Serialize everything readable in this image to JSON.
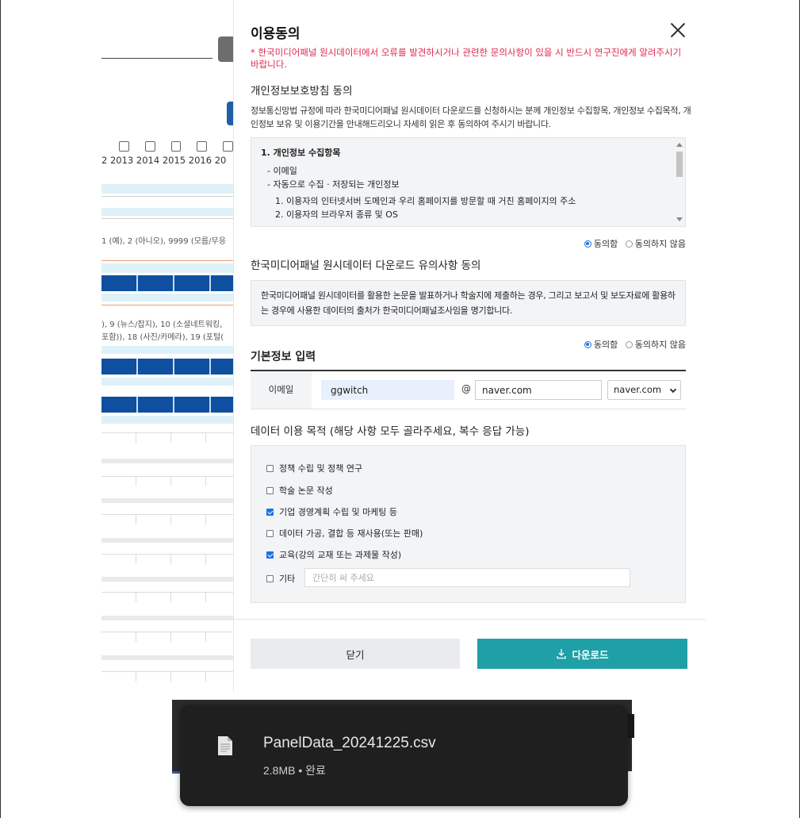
{
  "background": {
    "years": [
      "2",
      "2013",
      "2014",
      "2015",
      "2016",
      "20"
    ],
    "codes_1": "1 (예), 2 (아니오), 9999 (모름/무응",
    "codes_2a": "), 9 (뉴스/잡지), 10 (소셜네트워킹,",
    "codes_2b": "포함)), 18 (사진/카메라), 19 (포털("
  },
  "modal": {
    "title": "이용동의",
    "notice": "* 한국미디어패널 원시데이터에서 오류를 발견하시거나 관련한 문의사항이 있을 시 반드시 연구진에게 알려주시기 바랍니다.",
    "privacy": {
      "title": "개인정보보호방침 동의",
      "description": "정보통신망법 규정에 따라 한국미디어패널 원시데이터 다운로드를 신청하시는 분께 개인정보 수집항목, 개인정보 수집목적, 개인정보 보유 및 이용기간을 안내해드리오니 자세히 읽은 후 동의하여 주시기 바랍니다.",
      "box_title": "1. 개인정보 수집항목",
      "box_lines": [
        "- 이메일",
        "- 자동으로 수집 · 저장되는 개인정보"
      ],
      "box_sublines": [
        "1. 이용자의 인터넷서버 도메인과 우리 홈페이지를 방문할 때 거친 홈페이지의 주소",
        "2. 이용자의 브라우저 종류 및 OS"
      ],
      "agree_label": "동의함",
      "disagree_label": "동의하지 않음"
    },
    "caution": {
      "title": "한국미디어패널 원시데이터 다운로드 유의사항 동의",
      "text": "한국미디어패널 원시데이터를 활용한 논문을 발표하거나 학술지에 제출하는 경우, 그리고 보고서 및 보도자료에 활용하는 경우에 사용한 데이터의 출처가 한국미디어패널조사임을 명기합니다.",
      "agree_label": "동의함",
      "disagree_label": "동의하지 않음"
    },
    "basic_info": {
      "title": "기본정보 입력",
      "email_label": "이메일",
      "email_id": "ggwitch",
      "at": "@",
      "email_domain": "naver.com",
      "domain_select": "naver.com"
    },
    "purpose": {
      "title": "데이터 이용 목적 (해당 사항 모두 골라주세요, 복수 응답 가능)",
      "items": [
        {
          "label": "정책 수립 및 정책 연구",
          "checked": false
        },
        {
          "label": "학술 논문 작성",
          "checked": false
        },
        {
          "label": "기업 경영계획 수립 및 마케팅 등",
          "checked": true
        },
        {
          "label": "데이터 가공, 결합 등 재사용(또는 판매)",
          "checked": false
        },
        {
          "label": "교육(강의 교재 또는 과제물 작성)",
          "checked": true
        }
      ],
      "etc_label": "기타",
      "etc_placeholder": "간단히 써 주세요"
    },
    "buttons": {
      "close": "닫기",
      "download": "다운로드"
    }
  },
  "download_toast": {
    "file_name": "PanelData_20241225.csv",
    "meta": "2.8MB • 완료"
  },
  "colors": {
    "accent": "#1fa0a6",
    "notice_red": "#e0284f",
    "bg_blue": "#0e4fa0"
  }
}
